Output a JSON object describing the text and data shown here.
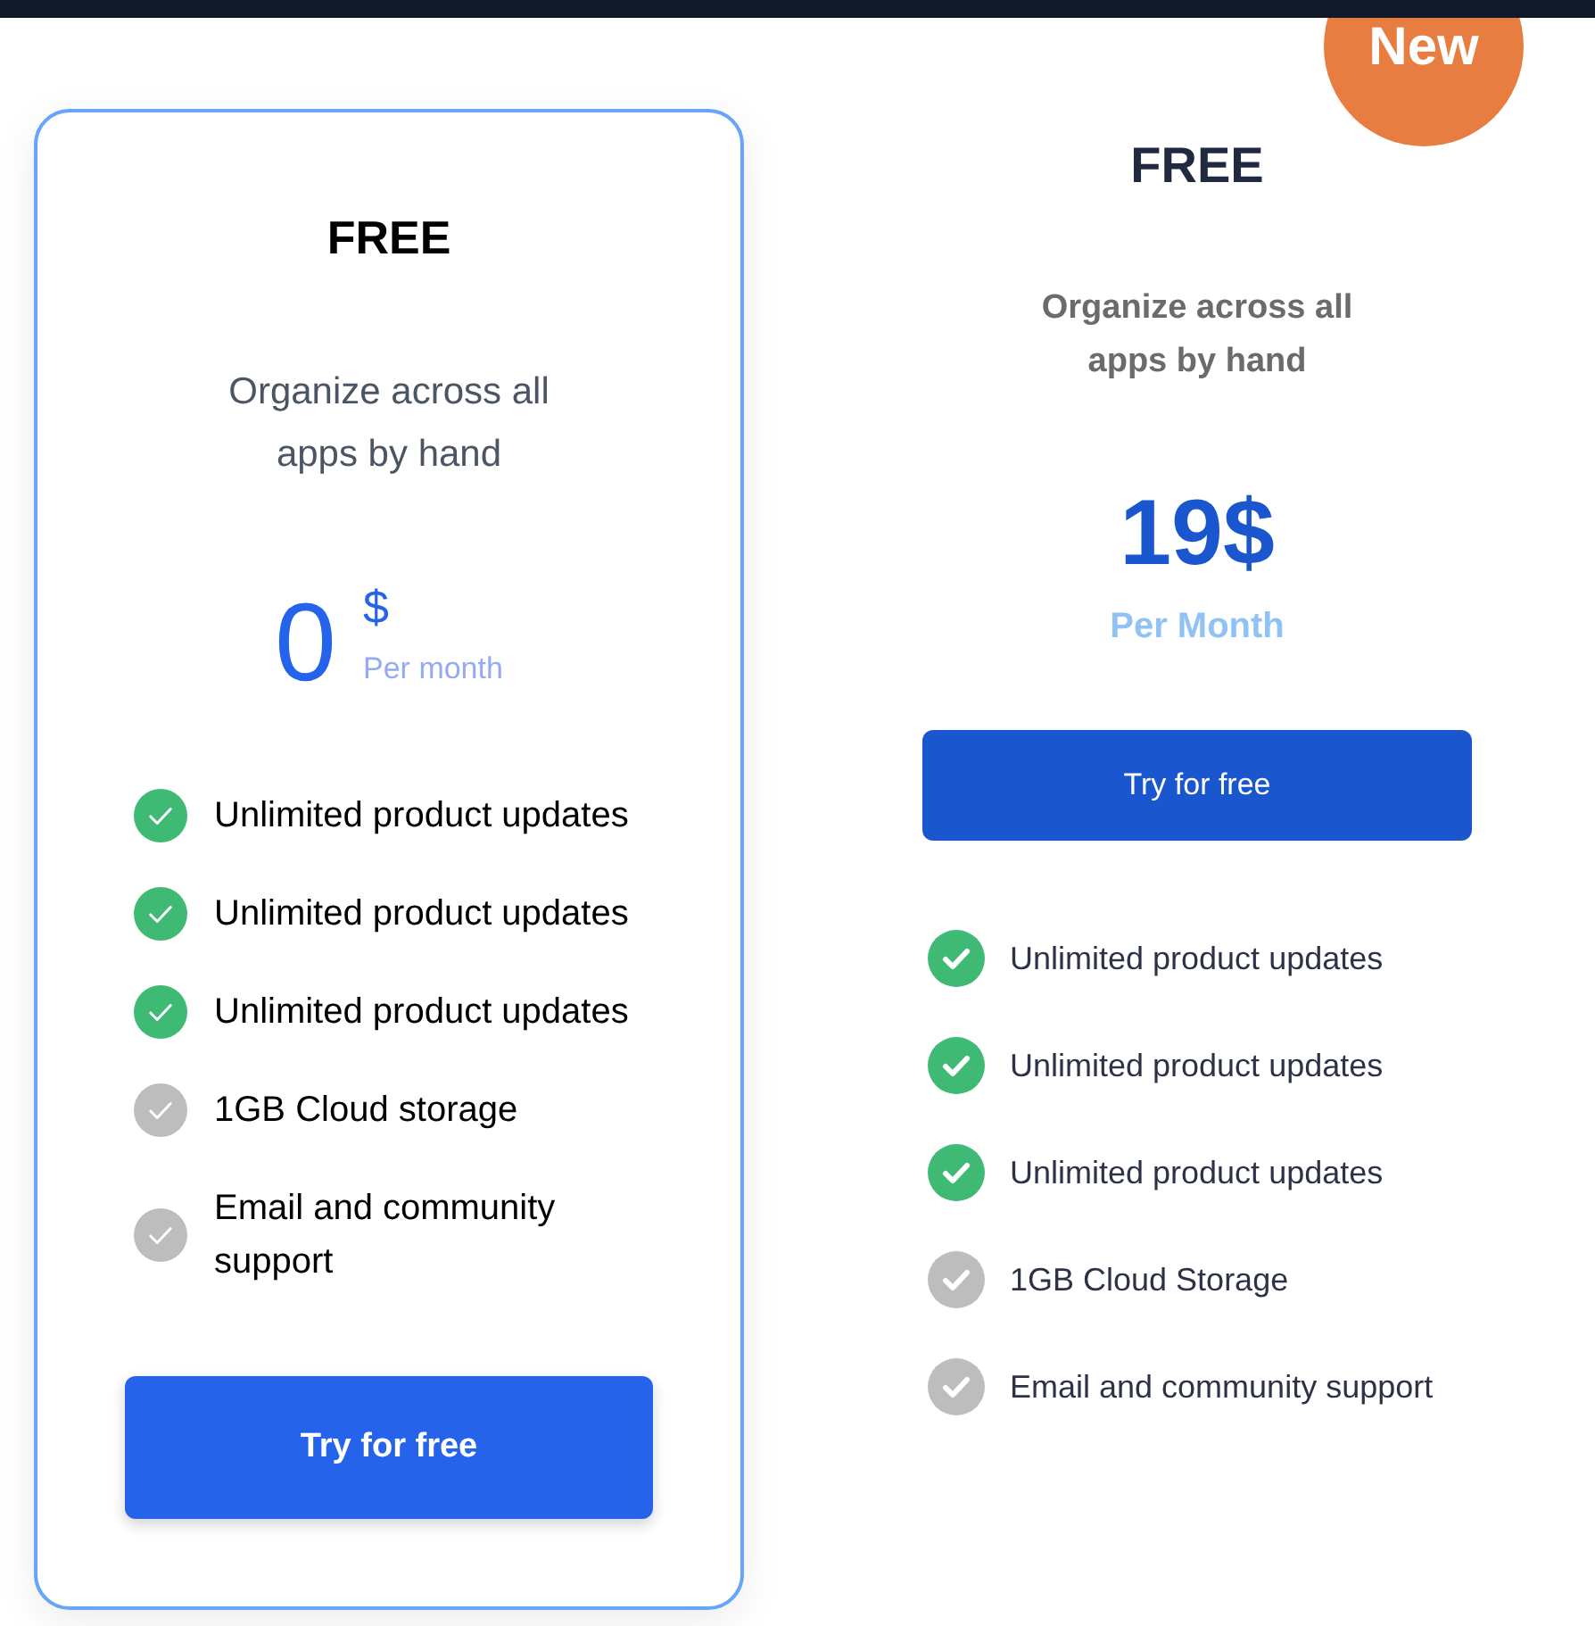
{
  "plans": [
    {
      "kind": "card",
      "title": "FREE",
      "description": "Organize across all apps by hand",
      "price": {
        "amount": "0",
        "currency": "$",
        "period": "Per month"
      },
      "features": [
        {
          "text": "Unlimited product updates",
          "included": true
        },
        {
          "text": "Unlimited product updates",
          "included": true
        },
        {
          "text": "Unlimited product updates",
          "included": true
        },
        {
          "text": "1GB Cloud storage",
          "included": false
        },
        {
          "text": "Email and community support",
          "included": false
        }
      ],
      "button": "Try for free"
    },
    {
      "kind": "plain",
      "badge": "New",
      "title": "FREE",
      "description": "Organize across all apps by hand",
      "price": {
        "amount": "19$",
        "period": "Per Month"
      },
      "button": "Try for free",
      "features": [
        {
          "text": "Unlimited product updates",
          "included": true
        },
        {
          "text": "Unlimited product updates",
          "included": true
        },
        {
          "text": "Unlimited product updates",
          "included": true
        },
        {
          "text": "1GB Cloud Storage",
          "included": false
        },
        {
          "text": "Email and community support",
          "included": false
        }
      ]
    }
  ]
}
